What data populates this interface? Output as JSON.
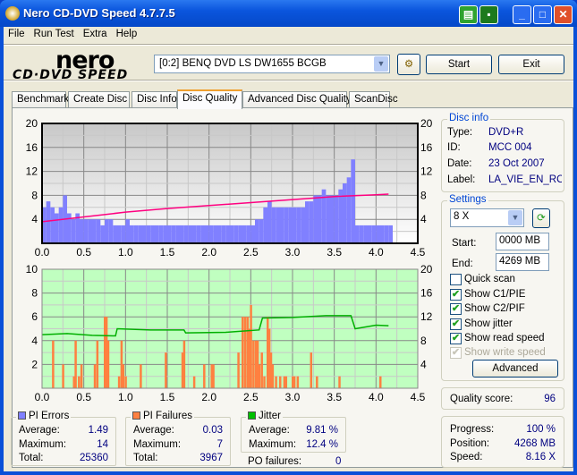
{
  "window": {
    "title": "Nero CD-DVD Speed 4.7.7.5"
  },
  "menu": [
    "File",
    "Run Test",
    "Extra",
    "Help"
  ],
  "logo": {
    "line1": "nero",
    "line2": "CD·DVD SPEED"
  },
  "toolbar": {
    "drive": "[0:2]  BENQ DVD LS DW1655 BCGB",
    "start": "Start",
    "exit": "Exit"
  },
  "tabs": [
    "Benchmark",
    "Create Disc",
    "Disc Info",
    "Disc Quality",
    "Advanced Disc Quality",
    "ScanDisc"
  ],
  "active_tab": "Disc Quality",
  "disc_info": {
    "title": "Disc info",
    "type_label": "Type:",
    "type": "DVD+R",
    "id_label": "ID:",
    "id": "MCC 004",
    "date_label": "Date:",
    "date": "23 Oct 2007",
    "label_label": "Label:",
    "label": "LA_VIE_EN_RO!"
  },
  "settings": {
    "title": "Settings",
    "speed": "8 X",
    "start_label": "Start:",
    "start": "0000 MB",
    "end_label": "End:",
    "end": "4269 MB",
    "checks": [
      {
        "label": "Quick scan",
        "checked": false,
        "enabled": true
      },
      {
        "label": "Show C1/PIE",
        "checked": true,
        "enabled": true
      },
      {
        "label": "Show C2/PIF",
        "checked": true,
        "enabled": true
      },
      {
        "label": "Show jitter",
        "checked": true,
        "enabled": true
      },
      {
        "label": "Show read speed",
        "checked": true,
        "enabled": true
      },
      {
        "label": "Show write speed",
        "checked": true,
        "enabled": false
      }
    ],
    "advanced": "Advanced"
  },
  "quality": {
    "label": "Quality score:",
    "value": "96"
  },
  "progress": {
    "progress_label": "Progress:",
    "progress": "100 %",
    "position_label": "Position:",
    "position": "4268 MB",
    "speed_label": "Speed:",
    "speed": "8.16 X"
  },
  "pi_errors": {
    "title": "PI Errors",
    "color": "#8080ff",
    "avg_label": "Average:",
    "avg": "1.49",
    "max_label": "Maximum:",
    "max": "14",
    "total_label": "Total:",
    "total": "25360"
  },
  "pi_failures": {
    "title": "PI Failures",
    "color": "#ff8040",
    "avg_label": "Average:",
    "avg": "0.03",
    "max_label": "Maximum:",
    "max": "7",
    "total_label": "Total:",
    "total": "3967"
  },
  "jitter": {
    "title": "Jitter",
    "color": "#00c000",
    "avg_label": "Average:",
    "avg": "9.81 %",
    "max_label": "Maximum:",
    "max": "12.4 %",
    "po_label": "PO failures:",
    "po": "0"
  },
  "chart_data": [
    {
      "type": "bar",
      "name": "pi-errors-chart",
      "xlim": [
        0,
        4.5
      ],
      "ylim": [
        0,
        20
      ],
      "y2lim": [
        0,
        20
      ],
      "xticks": [
        "0.0",
        "0.5",
        "1.0",
        "1.5",
        "2.0",
        "2.5",
        "3.0",
        "3.5",
        "4.0",
        "4.5"
      ],
      "yticks": [
        "4",
        "8",
        "12",
        "16",
        "20"
      ],
      "y2ticks": [
        "4",
        "8",
        "12",
        "16",
        "20"
      ],
      "x_step": 0.05,
      "pi_errors": [
        6,
        7,
        6,
        5,
        6,
        8,
        5,
        4,
        5,
        4,
        4,
        4,
        4,
        4,
        3,
        4,
        4,
        3,
        3,
        3,
        4,
        3,
        3,
        3,
        3,
        3,
        3,
        3,
        3,
        3,
        3,
        3,
        3,
        3,
        3,
        3,
        3,
        3,
        3,
        3,
        3,
        3,
        3,
        3,
        3,
        3,
        3,
        3,
        3,
        3,
        3,
        4,
        4,
        6,
        7,
        6,
        6,
        6,
        6,
        6,
        6,
        6,
        6,
        7,
        7,
        8,
        8,
        9,
        8,
        8,
        8,
        9,
        10,
        11,
        14,
        3,
        3,
        3,
        3,
        3,
        3,
        3,
        3,
        3
      ],
      "read_speed": {
        "x": [
          0,
          0.5,
          1.0,
          1.5,
          2.0,
          2.5,
          3.0,
          3.5,
          4.0,
          4.15
        ],
        "y": [
          3.6,
          4.4,
          5.2,
          5.8,
          6.3,
          6.8,
          7.3,
          7.8,
          8.1,
          8.2
        ]
      },
      "colors": {
        "pi_errors": "#8080ff",
        "read_speed": "#ff0080",
        "background": "#d8d8d8"
      },
      "grid": true
    },
    {
      "type": "bar",
      "name": "pi-failures-jitter-chart",
      "xlim": [
        0,
        4.5
      ],
      "ylim": [
        0,
        10
      ],
      "y2lim": [
        0,
        20
      ],
      "xticks": [
        "0.0",
        "0.5",
        "1.0",
        "1.5",
        "2.0",
        "2.5",
        "3.0",
        "3.5",
        "4.0",
        "4.5"
      ],
      "yticks": [
        "2",
        "4",
        "6",
        "8",
        "10"
      ],
      "y2ticks": [
        "4",
        "8",
        "12",
        "16",
        "20"
      ],
      "pi_failures": [
        [
          0.13,
          4
        ],
        [
          0.25,
          2
        ],
        [
          0.38,
          1
        ],
        [
          0.4,
          4
        ],
        [
          0.44,
          1
        ],
        [
          0.47,
          2
        ],
        [
          0.63,
          2
        ],
        [
          0.66,
          4
        ],
        [
          0.75,
          6
        ],
        [
          0.77,
          6
        ],
        [
          0.79,
          4
        ],
        [
          0.92,
          1
        ],
        [
          0.95,
          4
        ],
        [
          0.97,
          2
        ],
        [
          1.0,
          1
        ],
        [
          1.18,
          2
        ],
        [
          1.48,
          3
        ],
        [
          1.68,
          3
        ],
        [
          1.7,
          4
        ],
        [
          1.82,
          1
        ],
        [
          1.94,
          2
        ],
        [
          2.03,
          2
        ],
        [
          2.05,
          2
        ],
        [
          2.35,
          3
        ],
        [
          2.4,
          6
        ],
        [
          2.43,
          6
        ],
        [
          2.46,
          6
        ],
        [
          2.48,
          5
        ],
        [
          2.5,
          7
        ],
        [
          2.53,
          4
        ],
        [
          2.56,
          4
        ],
        [
          2.58,
          4
        ],
        [
          2.6,
          2
        ],
        [
          2.63,
          3
        ],
        [
          2.66,
          1
        ],
        [
          2.7,
          6
        ],
        [
          2.72,
          5
        ],
        [
          2.74,
          3
        ],
        [
          2.76,
          2
        ],
        [
          2.8,
          1
        ],
        [
          2.85,
          1
        ],
        [
          2.9,
          1
        ],
        [
          2.92,
          1
        ],
        [
          3.0,
          1
        ],
        [
          3.02,
          1
        ],
        [
          3.06,
          1
        ],
        [
          3.22,
          3
        ],
        [
          3.29,
          1
        ],
        [
          3.56,
          1
        ],
        [
          4.05,
          1
        ]
      ],
      "jitter": {
        "x": [
          0,
          0.3,
          0.6,
          0.88,
          0.9,
          1.3,
          1.7,
          1.72,
          2.2,
          2.6,
          2.64,
          3.0,
          3.4,
          3.7,
          3.75,
          4.0,
          4.15
        ],
        "y": [
          9.0,
          9.2,
          8.9,
          8.8,
          10.0,
          9.8,
          9.8,
          9.3,
          9.4,
          9.8,
          11.8,
          11.9,
          12.2,
          12.2,
          10.0,
          10.6,
          10.5
        ]
      },
      "colors": {
        "pi_failures": "#ff8040",
        "jitter": "#00b000",
        "background": "#c0ffc0"
      },
      "grid": true
    }
  ]
}
